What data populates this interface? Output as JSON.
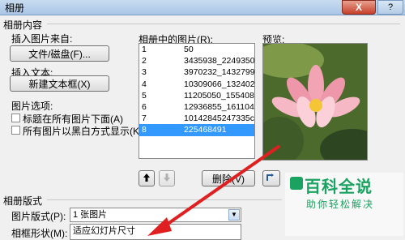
{
  "window": {
    "title": "相册",
    "close_label": "X",
    "help_label": "?"
  },
  "content": {
    "group_title": "相册内容",
    "insert_from_label": "插入图片来自:",
    "file_disk_button": "文件/磁盘(F)...",
    "insert_text_label": "插入文本:",
    "new_textbox_button": "新建文本框(X)",
    "picture_options_label": "图片选项:",
    "caption_below_label": "标题在所有图片下面(A)",
    "all_bw_label": "所有图片以黑白方式显示(K)"
  },
  "list": {
    "label": "相册中的图片(R):",
    "items": [
      {
        "num": "1",
        "name": "50"
      },
      {
        "num": "2",
        "name": "3435938_2249350870"
      },
      {
        "num": "3",
        "name": "3970232_1432799100"
      },
      {
        "num": "4",
        "name": "10309066_132402157"
      },
      {
        "num": "5",
        "name": "11205050_155408820"
      },
      {
        "num": "6",
        "name": "12936855_161104647"
      },
      {
        "num": "7",
        "name": "10142845247335cbb"
      },
      {
        "num": "8",
        "name": "225468491"
      }
    ],
    "selected_index": 7,
    "move_up_icon": "arrow-up",
    "move_down_icon": "arrow-down",
    "delete_button": "删除(V)"
  },
  "preview": {
    "label": "预览:"
  },
  "layout": {
    "group_title": "相册版式",
    "picture_layout_label": "图片版式(P):",
    "picture_layout_value": "1 张图片",
    "frame_shape_label": "相框形状(M):",
    "frame_shape_value": "适应幻灯片尺寸"
  },
  "watermark": {
    "title": "百科全说",
    "subtitle": "助你轻松解决"
  }
}
